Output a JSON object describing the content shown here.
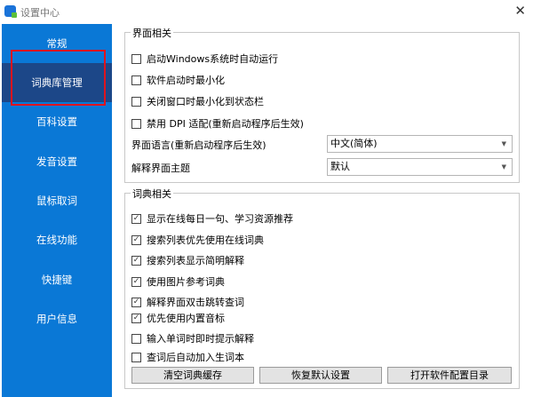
{
  "window": {
    "title": "设置中心",
    "close": "✕"
  },
  "sidebar": {
    "items": [
      {
        "label": "常规"
      },
      {
        "label": "词典库管理",
        "selected": true
      },
      {
        "label": "百科设置"
      },
      {
        "label": "发音设置"
      },
      {
        "label": "鼠标取词"
      },
      {
        "label": "在线功能"
      },
      {
        "label": "快捷键"
      },
      {
        "label": "用户信息"
      }
    ]
  },
  "ui_group": {
    "title": "界面相关",
    "options": [
      {
        "label": "启动Windows系统时自动运行",
        "checked": false
      },
      {
        "label": "软件启动时最小化",
        "checked": false
      },
      {
        "label": "关闭窗口时最小化到状态栏",
        "checked": false
      },
      {
        "label": "禁用 DPI 适配(重新启动程序后生效)",
        "checked": false
      }
    ],
    "language_label": "界面语言(重新启动程序后生效)",
    "language_value": "中文(简体)",
    "theme_label": "解释界面主题",
    "theme_value": "默认"
  },
  "dict_group": {
    "title": "词典相关",
    "options": [
      {
        "label": "显示在线每日一句、学习资源推荐",
        "checked": true
      },
      {
        "label": "搜索列表优先使用在线词典",
        "checked": true
      },
      {
        "label": "搜索列表显示简明解释",
        "checked": true
      },
      {
        "label": "使用图片参考词典",
        "checked": true
      },
      {
        "label": "解释界面双击跳转查词",
        "checked": true
      },
      {
        "label": "优先使用内置音标",
        "checked": true
      },
      {
        "label": "输入单词时即时提示解释",
        "checked": false
      },
      {
        "label": "查词后自动加入生词本",
        "checked": false
      }
    ],
    "buttons": [
      "清空词典缓存",
      "恢复默认设置",
      "打开软件配置目录"
    ]
  },
  "colors": {
    "sidebar": "#0a78d6",
    "selected": "#1c4788",
    "highlight": "#e0141e"
  }
}
